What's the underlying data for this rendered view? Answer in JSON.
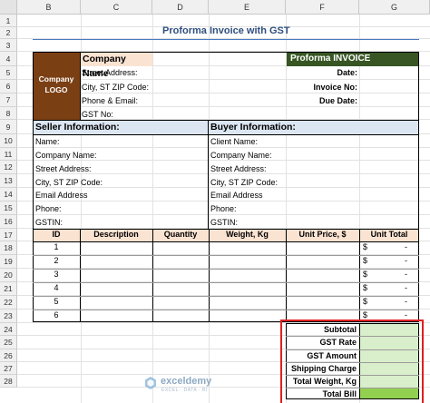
{
  "columns": [
    "B",
    "C",
    "D",
    "E",
    "F",
    "G"
  ],
  "rows": [
    "1",
    "2",
    "3",
    "4",
    "5",
    "6",
    "7",
    "8",
    "9",
    "10",
    "11",
    "12",
    "13",
    "14",
    "15",
    "16",
    "17",
    "18",
    "19",
    "20",
    "21",
    "22",
    "23",
    "24",
    "25",
    "26",
    "27",
    "28"
  ],
  "title": "Proforma Invoice with GST",
  "logo_text": "Company\nLOGO",
  "company": {
    "name": "Company Name",
    "lines": [
      "Street Address:",
      "City, ST  ZIP Code:",
      "Phone & Email:",
      "GST No:"
    ]
  },
  "proforma": {
    "header": "Proforma INVOICE",
    "lines": [
      "Date:",
      "Invoice No:",
      "Due Date:"
    ]
  },
  "seller": {
    "header": "Seller Information:",
    "fields": [
      "Name:",
      "Company Name:",
      "Street Address:",
      "City, ST  ZIP Code:",
      "Email Address",
      "Phone:",
      "GSTIN:"
    ]
  },
  "buyer": {
    "header": "Buyer Information:",
    "fields": [
      "Client Name:",
      "Company Name:",
      "Street Address:",
      "City, ST  ZIP Code:",
      "Email Address",
      "Phone:",
      "GSTIN:"
    ]
  },
  "items_table": {
    "headers": [
      "ID",
      "Description",
      "Quantity",
      "Weight, Kg",
      "Unit Price, $",
      "Unit Total"
    ],
    "ids": [
      "1",
      "2",
      "3",
      "4",
      "5",
      "6"
    ],
    "currency": "$",
    "total_placeholder": "-"
  },
  "summary": {
    "labels": [
      "Subtotal",
      "GST Rate",
      "GST Amount",
      "Shipping Charge",
      "Total Weight, Kg",
      "Total Bill"
    ]
  },
  "watermark": {
    "brand": "exceldemy",
    "tagline": "EXCEL · DATA · BI"
  },
  "colors": {
    "logo_bg": "#7b3f14",
    "company_name_bg": "#fbe3d2",
    "proforma_bg": "#375623",
    "section_header_bg": "#dce6f2",
    "summary_cell_bg": "#d9eecb",
    "total_bill_bg": "#92d050",
    "highlight_border": "#e02020"
  }
}
